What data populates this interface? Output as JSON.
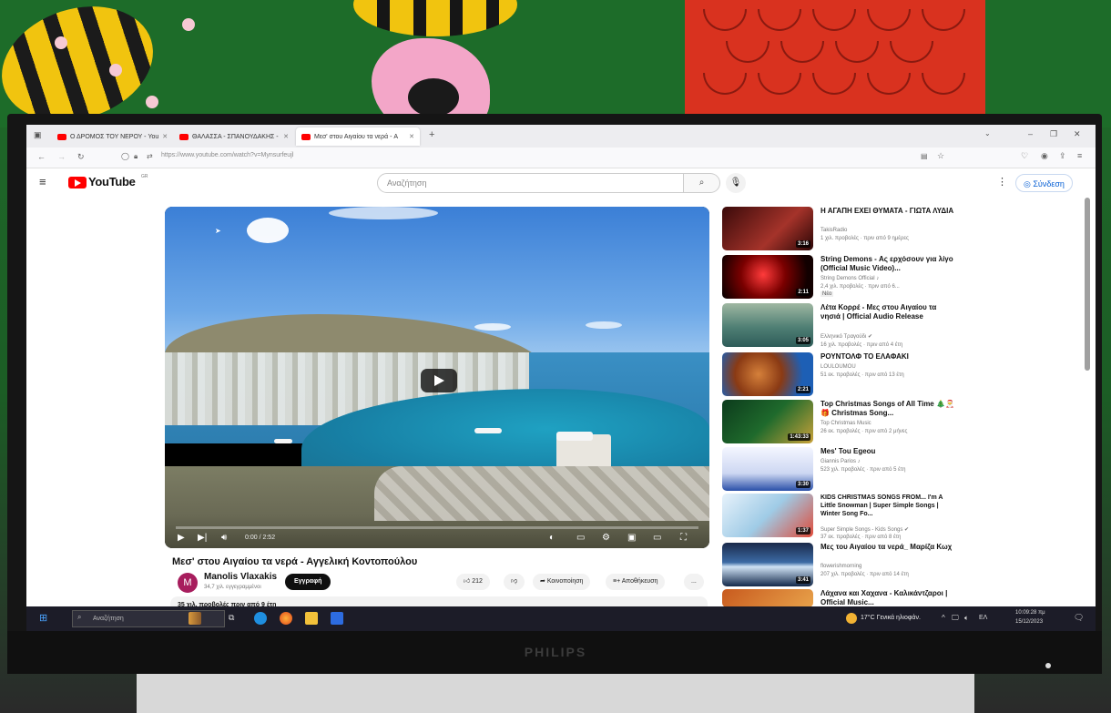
{
  "browser": {
    "tabs": [
      {
        "title": "Ο ΔΡΟΜΟΣ ΤΟΥ ΝΕΡΟΥ - You"
      },
      {
        "title": "ΘΑΛΑΣΣΑ - ΣΠΑΝΟΥΔΑΚΗΣ -"
      },
      {
        "title": "Μεσ' στου Αιγαίου τα νερά - A"
      }
    ],
    "url": "https://www.youtube.com/watch?v=Mynsurfeujl"
  },
  "youtube": {
    "logo_text": "YouTube",
    "country_code": "GR",
    "search_placeholder": "Αναζήτηση",
    "signin_label": "Σύνδεση"
  },
  "video": {
    "time": "0:00 / 2:52",
    "progress": 0,
    "title": "Μεσ' στου Αιγαίου τα νερά - Αγγελική Κοντοπούλου",
    "channel": "Manolis Vlaxakis",
    "avatar_letter": "M",
    "subscribers": "34,7 χιλ. εγγεγραμμένοι",
    "subscribe_label": "Εγγραφή",
    "likes": "212",
    "share_label": "Κοινοποίηση",
    "save_label": "Αποθήκευση",
    "more_label": "...",
    "description_meta": "35 χιλ. προβολές  πριν από 9 έτη"
  },
  "recommendations": [
    {
      "title": "Η ΑΓΑΠΗ ΕΧΕΙ ΘΥΜΑΤΑ - ΓΙΩΤΑ ΛΥΔΙΑ",
      "channel": "TakisRadio",
      "meta": "1 χιλ. προβολές · πριν από 9 ημέρες",
      "duration": "3:16",
      "badge": ""
    },
    {
      "title": "String Demons - Ας ερχόσουν για λίγο (Official Music Video)...",
      "channel": "String Demons Official ♪",
      "meta": "2,4 χιλ. προβολές · πριν από 6...",
      "duration": "2:11",
      "badge": "Νέο"
    },
    {
      "title": "Λέτα Κορρέ - Μες στου Αιγαίου τα νησιά | Official Audio Release",
      "channel": "Ελληνικό Τραγούδι ✔",
      "meta": "16 χιλ. προβολές · πριν από 4 έτη",
      "duration": "3:05",
      "badge": ""
    },
    {
      "title": "ΡΟΥΝΤΟΛΦ ΤΟ ΕΛΑΦΑΚΙ",
      "channel": "LOULOUMOU",
      "meta": "51 εκ. προβολές · πριν από 13 έτη",
      "duration": "2:21",
      "badge": ""
    },
    {
      "title": "Top Christmas Songs of All Time 🎄🎅🎁 Christmas Song...",
      "channel": "Top Christmas Music",
      "meta": "26 εκ. προβολές · πριν από 2 μήνες",
      "duration": "1:43:33",
      "badge": ""
    },
    {
      "title": "Mes' Tou Egeou",
      "channel": "Giannis Parios ♪",
      "meta": "523 χιλ. προβολές · πριν από 5 έτη",
      "duration": "3:30",
      "badge": ""
    },
    {
      "title": "KIDS CHRISTMAS SONGS FROM... I'm A Little Snowman | Super Simple Songs | Winter Song Fo...",
      "channel": "Super Simple Songs - Kids Songs ✔",
      "meta": "37 εκ. προβολές · πριν από 8 έτη",
      "duration": "1:37",
      "badge": ""
    },
    {
      "title": "Μες του Αιγαίου τα νερά_ Μαρίζα Κωχ",
      "channel": "flowerishmorning",
      "meta": "207 χιλ. προβολές · πριν από 14 έτη",
      "duration": "3:41",
      "badge": ""
    },
    {
      "title": "Λάχανα και Χαχανα - Καλικάντζαροι | Official Music...",
      "channel": "Habana Kids ♪",
      "meta": "",
      "duration": "",
      "badge": ""
    }
  ],
  "taskbar": {
    "search_placeholder": "Αναζήτηση",
    "weather": "17°C Γενικά ηλιοφάν.",
    "language": "ΕΛ",
    "time": "10:09:28 πμ",
    "date": "15/12/2023"
  },
  "monitor": {
    "brand": "PHILIPS"
  }
}
